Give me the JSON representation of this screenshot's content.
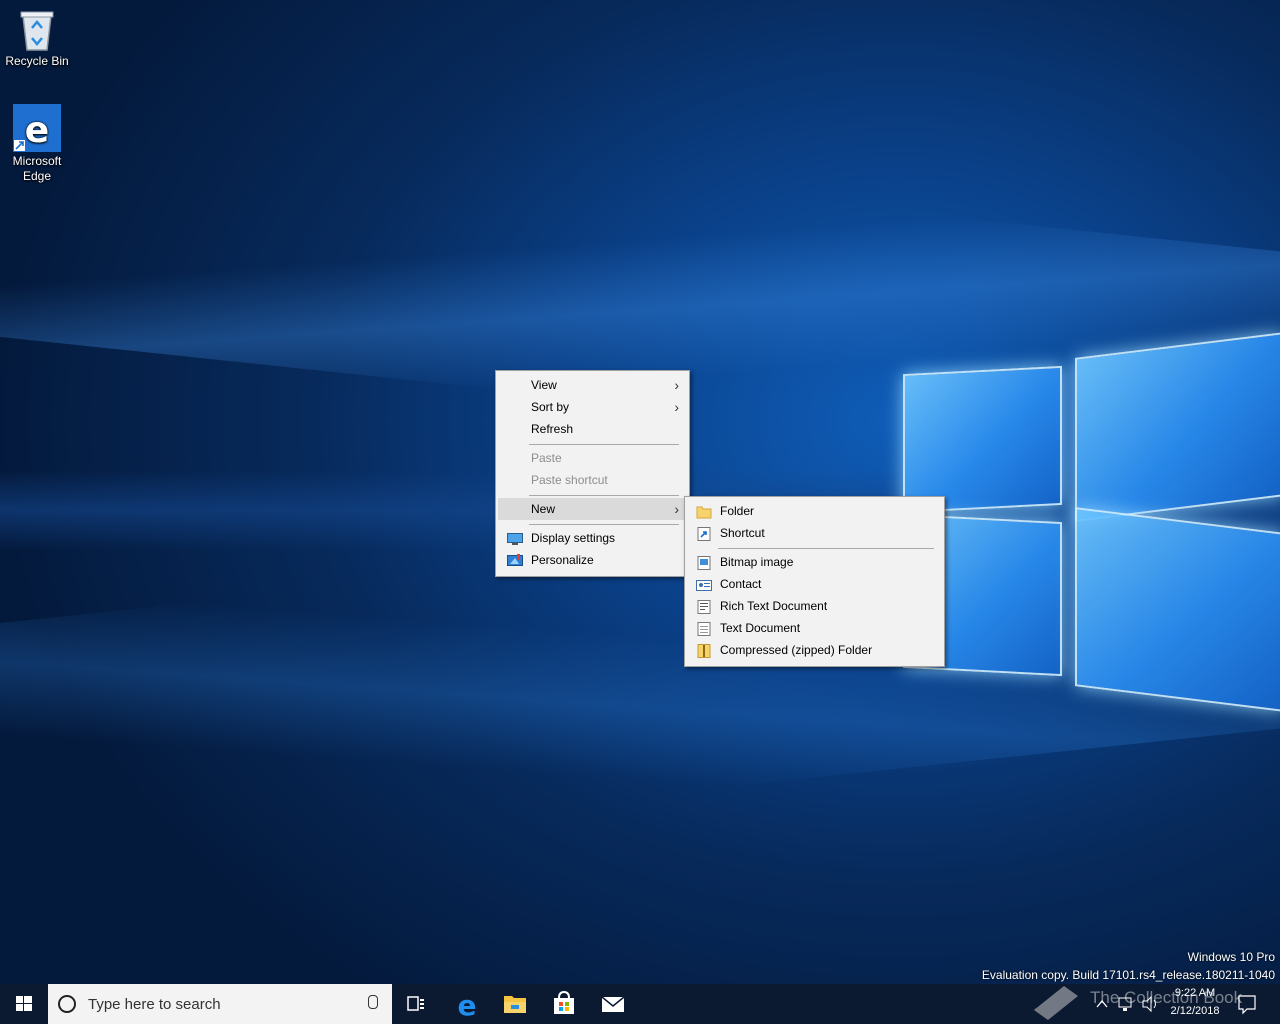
{
  "desktop": {
    "icons": [
      {
        "label": "Recycle Bin"
      },
      {
        "label_line1": "Microsoft",
        "label_line2": "Edge"
      }
    ],
    "watermark": {
      "line1": "Windows 10 Pro",
      "line2": "Evaluation copy. Build 17101.rs4_release.180211-1040"
    }
  },
  "context_menu": {
    "items": [
      {
        "label": "View",
        "has_submenu": true
      },
      {
        "label": "Sort by",
        "has_submenu": true
      },
      {
        "label": "Refresh"
      },
      {
        "label": "Paste",
        "disabled": true
      },
      {
        "label": "Paste shortcut",
        "disabled": true
      },
      {
        "label": "New",
        "has_submenu": true,
        "highlighted": true
      },
      {
        "label": "Display settings",
        "icon": "display-icon"
      },
      {
        "label": "Personalize",
        "icon": "personalize-icon"
      }
    ],
    "arrow": "›"
  },
  "new_submenu": {
    "items": [
      {
        "label": "Folder",
        "icon": "folder-icon"
      },
      {
        "label": "Shortcut",
        "icon": "shortcut-icon"
      },
      {
        "label": "Bitmap image",
        "icon": "bitmap-icon"
      },
      {
        "label": "Contact",
        "icon": "contact-icon"
      },
      {
        "label": "Rich Text Document",
        "icon": "rich-text-icon"
      },
      {
        "label": "Text Document",
        "icon": "text-document-icon"
      },
      {
        "label": "Compressed (zipped) Folder",
        "icon": "zip-folder-icon"
      }
    ]
  },
  "taskbar": {
    "search_placeholder": "Type here to search",
    "time": "9:22 AM",
    "date": "2/12/2018",
    "overlay_text": "The Collection Book"
  },
  "colors": {
    "taskbar": "#0b1a31",
    "menu_background": "#f2f2f2",
    "menu_highlight": "#dadada",
    "accent": "#1e6fd0"
  }
}
